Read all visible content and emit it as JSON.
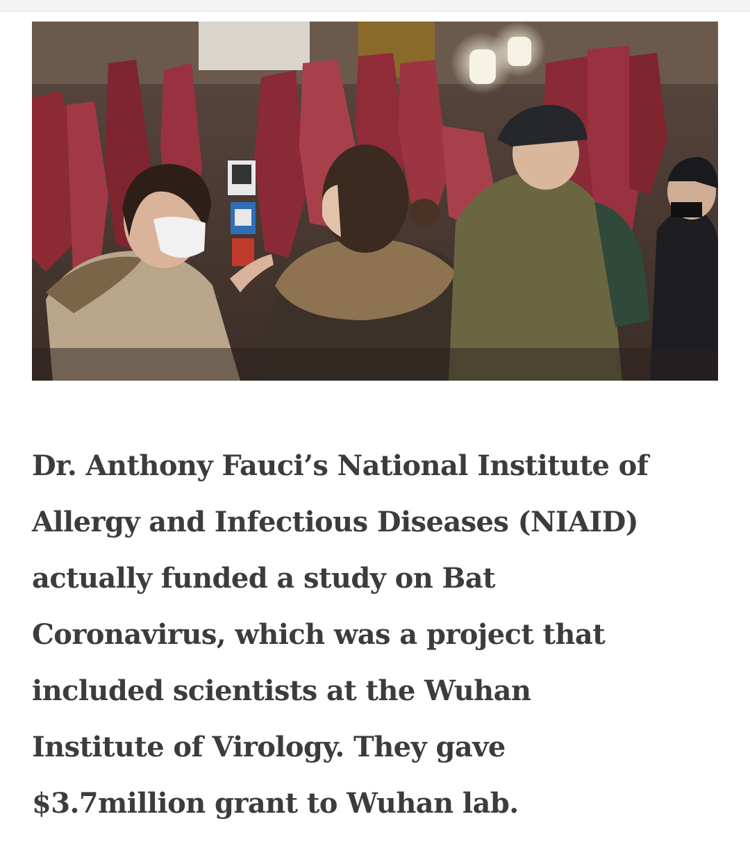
{
  "article": {
    "lines": [
      "Dr. Anthony Fauci’s National Institute of",
      "Allergy and Infectious Diseases (NIAID)",
      "actually funded a study on Bat",
      "Coronavirus, which was a project that",
      "included scientists at the Wuhan",
      "Institute of Virology. They gave",
      "$3.7million grant to Wuhan lab."
    ]
  },
  "colors": {
    "text": "#3c3c3c",
    "background": "#ffffff"
  }
}
